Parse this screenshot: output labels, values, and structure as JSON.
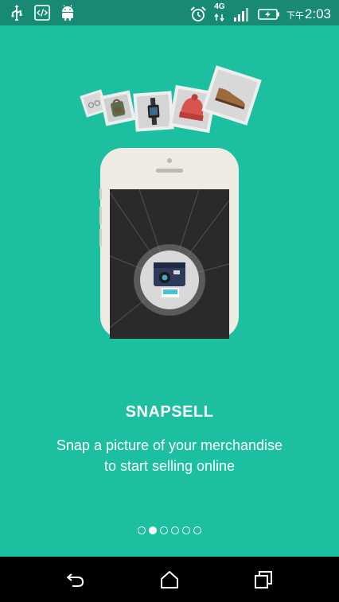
{
  "status_bar": {
    "left_icons": [
      "usb-icon",
      "developer-code-icon",
      "android-icon"
    ],
    "alarm_icon": "alarm-clock-icon",
    "network_label": "4G",
    "signal_icon": "signal-bars-icon",
    "battery_icon": "battery-charging-icon",
    "clock_prefix": "下午",
    "clock_time": "2:03"
  },
  "onboarding": {
    "title": "SNAPSELL",
    "subtitle_line1": "Snap a picture of your merchandise",
    "subtitle_line2": "to start selling online",
    "page_count": 6,
    "active_page": 2
  },
  "colors": {
    "background": "#1cc0a0",
    "status_bar": "#188a74",
    "text": "#ffffff",
    "nav_bar": "#000000"
  },
  "nav_bar": {
    "back_icon": "back-arrow-icon",
    "home_icon": "home-icon",
    "recents_icon": "recent-apps-icon"
  }
}
